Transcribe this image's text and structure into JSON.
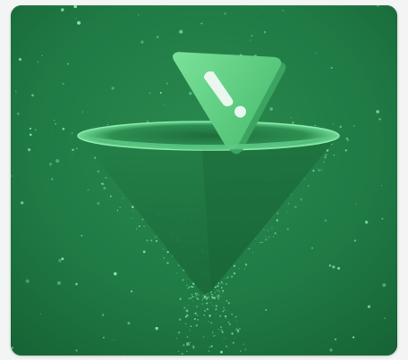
{
  "image": {
    "subject": "warning-funnel-illustration",
    "colors": {
      "background": "#1f7a44",
      "background_dark": "#166235",
      "funnel_top": "#2f9a5a",
      "funnel_body": "#1b6e3c",
      "funnel_rim": "#66d08f",
      "sign": "#5fcf80",
      "sign_shadow": "#3aa460",
      "exclamation": "#e9f7ee",
      "particles": "#8ff0b0"
    }
  }
}
